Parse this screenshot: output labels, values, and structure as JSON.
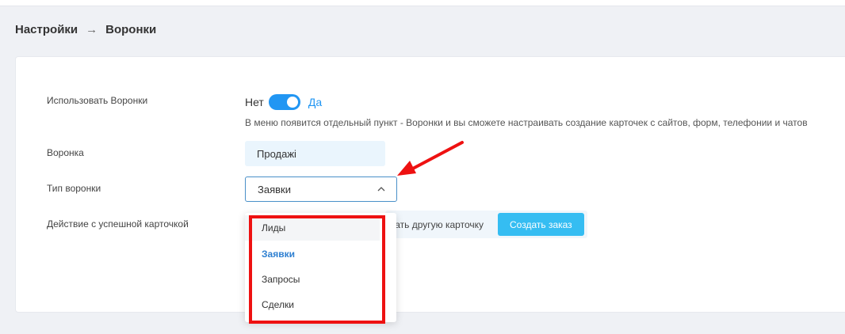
{
  "breadcrumb": {
    "section": "Настройки",
    "separator": "→",
    "page": "Воронки"
  },
  "settings": {
    "use_funnels": {
      "label": "Использовать Воронки",
      "off_label": "Нет",
      "on_label": "Да",
      "enabled": true,
      "hint": "В меню появится отдельный пункт - Воронки и вы сможете настраивать создание карточек с сайтов, форм, телефонии и чатов"
    },
    "funnel": {
      "label": "Воронка",
      "value": "Продажі"
    },
    "funnel_type": {
      "label": "Тип воронки",
      "value": "Заявки",
      "options": [
        "Лиды",
        "Заявки",
        "Запросы",
        "Сделки"
      ],
      "selected_index": 1,
      "hovered_index": 0
    },
    "success_action": {
      "label": "Действие с успешной карточкой",
      "option_text": "здать другую карточку",
      "button_label": "Создать заказ"
    }
  },
  "colors": {
    "accent": "#2196f3",
    "button": "#35bdf2",
    "annotation": "#ee1111"
  }
}
